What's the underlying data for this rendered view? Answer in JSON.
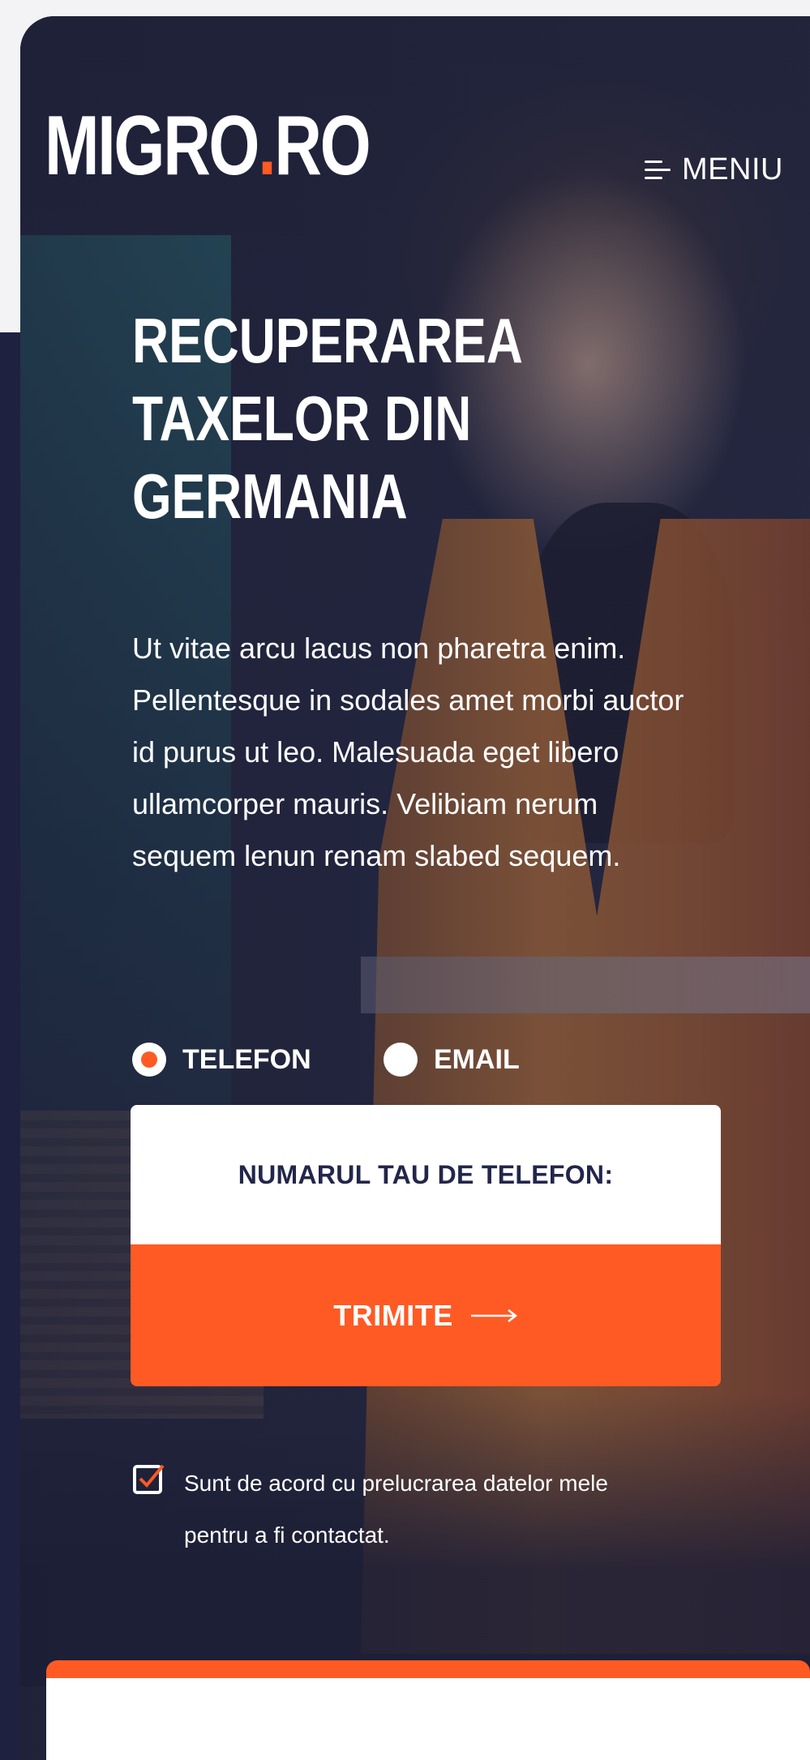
{
  "header": {
    "logo_main": "MIGRO",
    "logo_dot": ".",
    "logo_suffix": "RO",
    "menu_label": "MENIU"
  },
  "hero": {
    "title_lines": [
      "RECUPERAREA",
      "TAXELOR DIN",
      "GERMANIA"
    ],
    "description": "Ut vitae arcu lacus non pharetra enim. Pellentesque in sodales amet morbi auctor id purus ut leo. Malesuada eget libero ullamcorper mauris. Velibiam nerum sequem lenun renam slabed sequem."
  },
  "contact_method": {
    "options": [
      {
        "label": "TELEFON",
        "selected": true
      },
      {
        "label": "EMAIL",
        "selected": false
      }
    ]
  },
  "form": {
    "phone_placeholder": "NUMARUL TAU DE TELEFON:",
    "submit_label": "TRIMITE",
    "consent_text": "Sunt de acord cu prelucrarea datelor mele pentru a fi contactat.",
    "consent_checked": true
  },
  "colors": {
    "accent": "#ff5a24",
    "navy": "#1f2140",
    "text_on_dark": "#ffffff",
    "field_text": "#22264a"
  },
  "icons": {
    "menu": "hamburger-menu-icon",
    "submit": "arrow-right-icon",
    "consent": "checkbox-checked-icon"
  }
}
